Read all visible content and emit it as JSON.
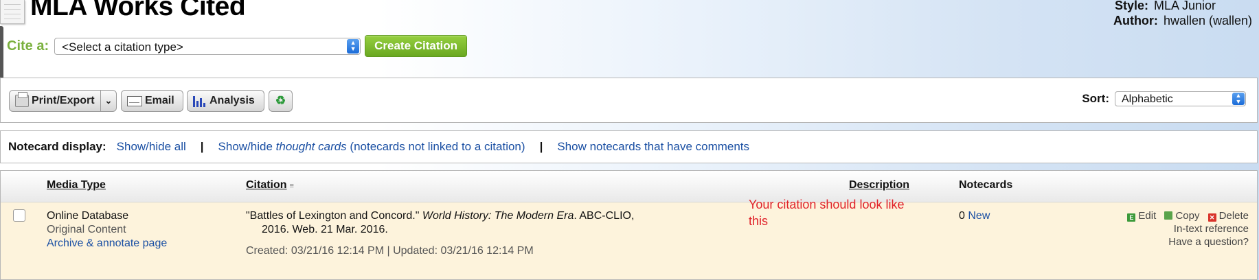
{
  "header": {
    "title": "MLA Works Cited",
    "style_label": "Style:",
    "style_value": "MLA Junior",
    "author_label": "Author:",
    "author_value": "hwallen (wallen)"
  },
  "cite": {
    "label": "Cite a:",
    "select_value": "<Select a citation type>",
    "create_button": "Create Citation"
  },
  "toolbar": {
    "print_export": "Print/Export",
    "email": "Email",
    "analysis": "Analysis",
    "recycle_icon": "recycle-icon",
    "sort_label": "Sort:",
    "sort_value": "Alphabetic"
  },
  "notecard_bar": {
    "label": "Notecard display:",
    "show_hide_all": "Show/hide all",
    "sep1": "|",
    "show_hide_prefix": "Show/hide ",
    "thought_cards": "thought cards",
    "thought_suffix": " (notecards not linked to a citation)",
    "sep2": "|",
    "show_comments": "Show notecards that have comments"
  },
  "table": {
    "headers": {
      "media_type": "Media Type",
      "citation": "Citation",
      "description": "Description",
      "notecards": "Notecards"
    },
    "rows": [
      {
        "media_type": "Online Database",
        "media_sub": "Original Content",
        "archive_link": "Archive & annotate page",
        "citation_part1": "\"Battles of Lexington and Concord.\" ",
        "citation_italic": "World History: The Modern Era",
        "citation_part2": ". ABC-CLIO,",
        "citation_line2": "2016. Web. 21 Mar. 2016.",
        "created": "Created: 03/21/16 12:14 PM | Updated: 03/21/16 12:14 PM",
        "notecard_count": "0",
        "notecard_new": "New",
        "edit": "Edit",
        "copy": "Copy",
        "delete": "Delete",
        "in_text": "In-text reference",
        "question": "Have a question?"
      }
    ]
  },
  "annotation": {
    "line1": "Your citation should look like",
    "line2": "this",
    "color": "#e0222a"
  },
  "colors": {
    "accent_green": "#7ab03e",
    "link_blue": "#1a4fa3",
    "row_background": "#fdf3dc"
  }
}
